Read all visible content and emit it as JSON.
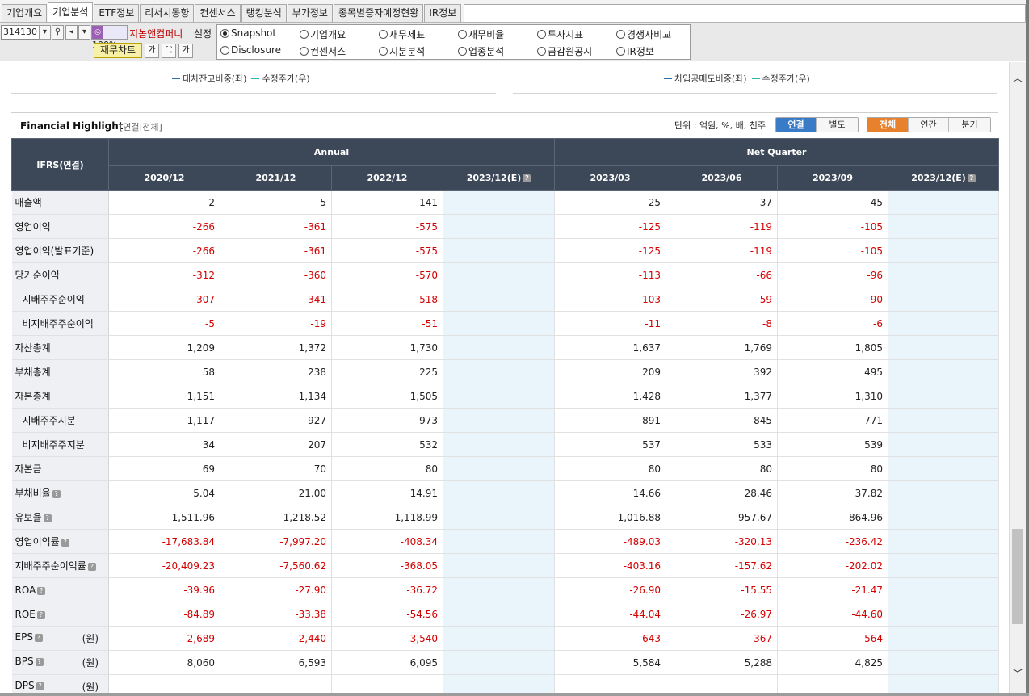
{
  "tabs": [
    {
      "label": "기업개요",
      "active": false
    },
    {
      "label": "기업분석",
      "active": true
    },
    {
      "label": "ETF정보",
      "active": false
    },
    {
      "label": "리서치동향",
      "active": false
    },
    {
      "label": "컨센서스",
      "active": false
    },
    {
      "label": "랭킹분석",
      "active": false
    },
    {
      "label": "부가정보",
      "active": false
    },
    {
      "label": "종목별증자예정현황",
      "active": false
    },
    {
      "label": "IR정보",
      "active": false
    }
  ],
  "toolbar": {
    "stock_code": "314130",
    "zoom": "100%",
    "company_name": "지놈앤컴퍼니",
    "setting_label": "설정",
    "fin_chart_label": "재무차트",
    "radios": [
      {
        "label": "Snapshot",
        "checked": true
      },
      {
        "label": "기업개요",
        "checked": false
      },
      {
        "label": "재무제표",
        "checked": false
      },
      {
        "label": "재무비율",
        "checked": false
      },
      {
        "label": "투자지표",
        "checked": false
      },
      {
        "label": "경쟁사비교",
        "checked": false
      },
      {
        "label": "Disclosure",
        "checked": false
      },
      {
        "label": "컨센서스",
        "checked": false
      },
      {
        "label": "지분분석",
        "checked": false
      },
      {
        "label": "업종분석",
        "checked": false
      },
      {
        "label": "금감원공시",
        "checked": false
      },
      {
        "label": "IR정보",
        "checked": false
      }
    ]
  },
  "charts_legend": {
    "left": [
      "대차잔고비중(좌)",
      "수정주가(우)"
    ],
    "right": [
      "차입공매도비중(좌)",
      "수정주가(우)"
    ],
    "colors": [
      "#2e6fad",
      "#2bb5b0"
    ]
  },
  "highlight": {
    "title": "Financial Highlight",
    "subtitle": "[연결|전체]",
    "unit_text": "단위 : 억원, %, 배, 천주",
    "consolidation_options": [
      "연결",
      "별도"
    ],
    "period_options": [
      "전체",
      "연간",
      "분기"
    ],
    "corner_header": "IFRS(연결)",
    "group_annual": "Annual",
    "group_quarter": "Net Quarter",
    "periods": [
      "2020/12",
      "2021/12",
      "2022/12",
      "2023/12(E)",
      "2023/03",
      "2023/06",
      "2023/09",
      "2023/12(E)"
    ],
    "rows": [
      {
        "label": "매출액",
        "indent": false,
        "help": false,
        "unit": "",
        "values": [
          "2",
          "5",
          "141",
          "",
          "25",
          "37",
          "45",
          ""
        ]
      },
      {
        "label": "영업이익",
        "indent": false,
        "help": false,
        "unit": "",
        "values": [
          "-266",
          "-361",
          "-575",
          "",
          "-125",
          "-119",
          "-105",
          ""
        ]
      },
      {
        "label": "영업이익(발표기준)",
        "indent": false,
        "help": false,
        "unit": "",
        "values": [
          "-266",
          "-361",
          "-575",
          "",
          "-125",
          "-119",
          "-105",
          ""
        ]
      },
      {
        "label": "당기순이익",
        "indent": false,
        "help": false,
        "unit": "",
        "values": [
          "-312",
          "-360",
          "-570",
          "",
          "-113",
          "-66",
          "-96",
          ""
        ]
      },
      {
        "label": "지배주주순이익",
        "indent": true,
        "help": false,
        "unit": "",
        "values": [
          "-307",
          "-341",
          "-518",
          "",
          "-103",
          "-59",
          "-90",
          ""
        ]
      },
      {
        "label": "비지배주주순이익",
        "indent": true,
        "help": false,
        "unit": "",
        "values": [
          "-5",
          "-19",
          "-51",
          "",
          "-11",
          "-8",
          "-6",
          ""
        ]
      },
      {
        "label": "자산총계",
        "indent": false,
        "help": false,
        "unit": "",
        "values": [
          "1,209",
          "1,372",
          "1,730",
          "",
          "1,637",
          "1,769",
          "1,805",
          ""
        ]
      },
      {
        "label": "부채총계",
        "indent": false,
        "help": false,
        "unit": "",
        "values": [
          "58",
          "238",
          "225",
          "",
          "209",
          "392",
          "495",
          ""
        ]
      },
      {
        "label": "자본총계",
        "indent": false,
        "help": false,
        "unit": "",
        "values": [
          "1,151",
          "1,134",
          "1,505",
          "",
          "1,428",
          "1,377",
          "1,310",
          ""
        ]
      },
      {
        "label": "지배주주지분",
        "indent": true,
        "help": false,
        "unit": "",
        "values": [
          "1,117",
          "927",
          "973",
          "",
          "891",
          "845",
          "771",
          ""
        ]
      },
      {
        "label": "비지배주주지분",
        "indent": true,
        "help": false,
        "unit": "",
        "values": [
          "34",
          "207",
          "532",
          "",
          "537",
          "533",
          "539",
          ""
        ]
      },
      {
        "label": "자본금",
        "indent": false,
        "help": false,
        "unit": "",
        "values": [
          "69",
          "70",
          "80",
          "",
          "80",
          "80",
          "80",
          ""
        ]
      },
      {
        "label": "부채비율",
        "indent": false,
        "help": true,
        "unit": "",
        "values": [
          "5.04",
          "21.00",
          "14.91",
          "",
          "14.66",
          "28.46",
          "37.82",
          ""
        ]
      },
      {
        "label": "유보율",
        "indent": false,
        "help": true,
        "unit": "",
        "values": [
          "1,511.96",
          "1,218.52",
          "1,118.99",
          "",
          "1,016.88",
          "957.67",
          "864.96",
          ""
        ]
      },
      {
        "label": "영업이익률",
        "indent": false,
        "help": true,
        "unit": "",
        "values": [
          "-17,683.84",
          "-7,997.20",
          "-408.34",
          "",
          "-489.03",
          "-320.13",
          "-236.42",
          ""
        ]
      },
      {
        "label": "지배주주순이익률",
        "indent": false,
        "help": true,
        "unit": "",
        "values": [
          "-20,409.23",
          "-7,560.62",
          "-368.05",
          "",
          "-403.16",
          "-157.62",
          "-202.02",
          ""
        ]
      },
      {
        "label": "ROA",
        "indent": false,
        "help": true,
        "unit": "",
        "values": [
          "-39.96",
          "-27.90",
          "-36.72",
          "",
          "-26.90",
          "-15.55",
          "-21.47",
          ""
        ]
      },
      {
        "label": "ROE",
        "indent": false,
        "help": true,
        "unit": "",
        "values": [
          "-84.89",
          "-33.38",
          "-54.56",
          "",
          "-44.04",
          "-26.97",
          "-44.60",
          ""
        ]
      },
      {
        "label": "EPS",
        "indent": false,
        "help": true,
        "unit": "(원)",
        "values": [
          "-2,689",
          "-2,440",
          "-3,540",
          "",
          "-643",
          "-367",
          "-564",
          ""
        ]
      },
      {
        "label": "BPS",
        "indent": false,
        "help": true,
        "unit": "(원)",
        "values": [
          "8,060",
          "6,593",
          "6,095",
          "",
          "5,584",
          "5,288",
          "4,825",
          ""
        ]
      },
      {
        "label": "DPS",
        "indent": false,
        "help": true,
        "unit": "(원)",
        "values": [
          "",
          "",
          "",
          "",
          "",
          "",
          "",
          ""
        ]
      }
    ]
  }
}
